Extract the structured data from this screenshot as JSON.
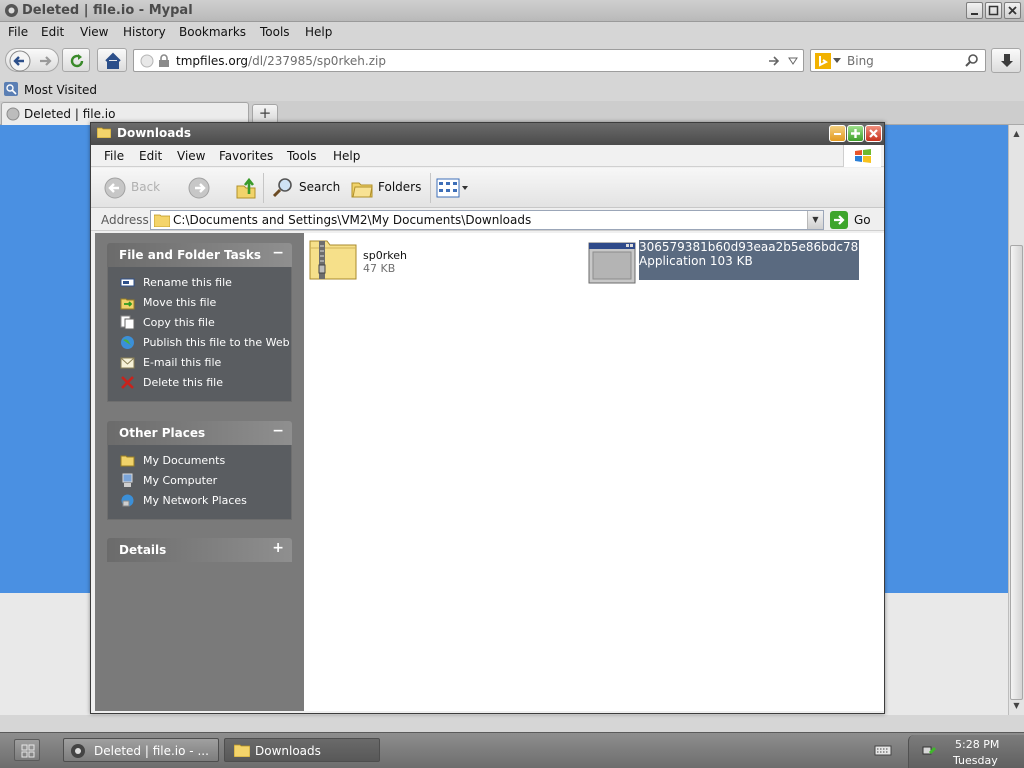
{
  "browser": {
    "title": "Deleted | file.io - Mypal",
    "menu": [
      "File",
      "Edit",
      "View",
      "History",
      "Bookmarks",
      "Tools",
      "Help"
    ],
    "url_domain": "tmpfiles.org",
    "url_path": "/dl/237985/sp0rkeh.zip",
    "search_engine": "Bing",
    "bookmarks_item": "Most Visited",
    "tab_title": "Deleted | file.io",
    "new_tab": "+"
  },
  "explorer": {
    "title": "Downloads",
    "menu": [
      "File",
      "Edit",
      "View",
      "Favorites",
      "Tools",
      "Help"
    ],
    "toolbar": {
      "back": "Back",
      "search": "Search",
      "folders": "Folders"
    },
    "address_label": "Address",
    "address_value": "C:\\Documents and Settings\\VM2\\My Documents\\Downloads",
    "go_label": "Go",
    "tasks_panel": {
      "title": "File and Folder Tasks",
      "toggle": "−",
      "items": [
        "Rename this file",
        "Move this file",
        "Copy this file",
        "Publish this file to the Web",
        "E-mail this file",
        "Delete this file"
      ]
    },
    "places_panel": {
      "title": "Other Places",
      "toggle": "−",
      "items": [
        "My Documents",
        "My Computer",
        "My Network Places"
      ]
    },
    "details_panel": {
      "title": "Details",
      "toggle": "+"
    },
    "files": [
      {
        "name": "sp0rkeh",
        "meta": "47 KB",
        "icon": "zip-folder-icon"
      },
      {
        "name": "306579381b60d93eaa2b5e86bdc78...",
        "type": "Application",
        "meta": "103 KB",
        "icon": "application-icon"
      }
    ]
  },
  "taskbar": {
    "buttons": [
      "Deleted | file.io - ...",
      "Downloads"
    ],
    "time": "5:28 PM",
    "day": "Tuesday"
  },
  "colors": {
    "page_blue": "#4a90e2",
    "taskpane_grey": "#7a7a7a",
    "selection": "#5a6a80"
  }
}
